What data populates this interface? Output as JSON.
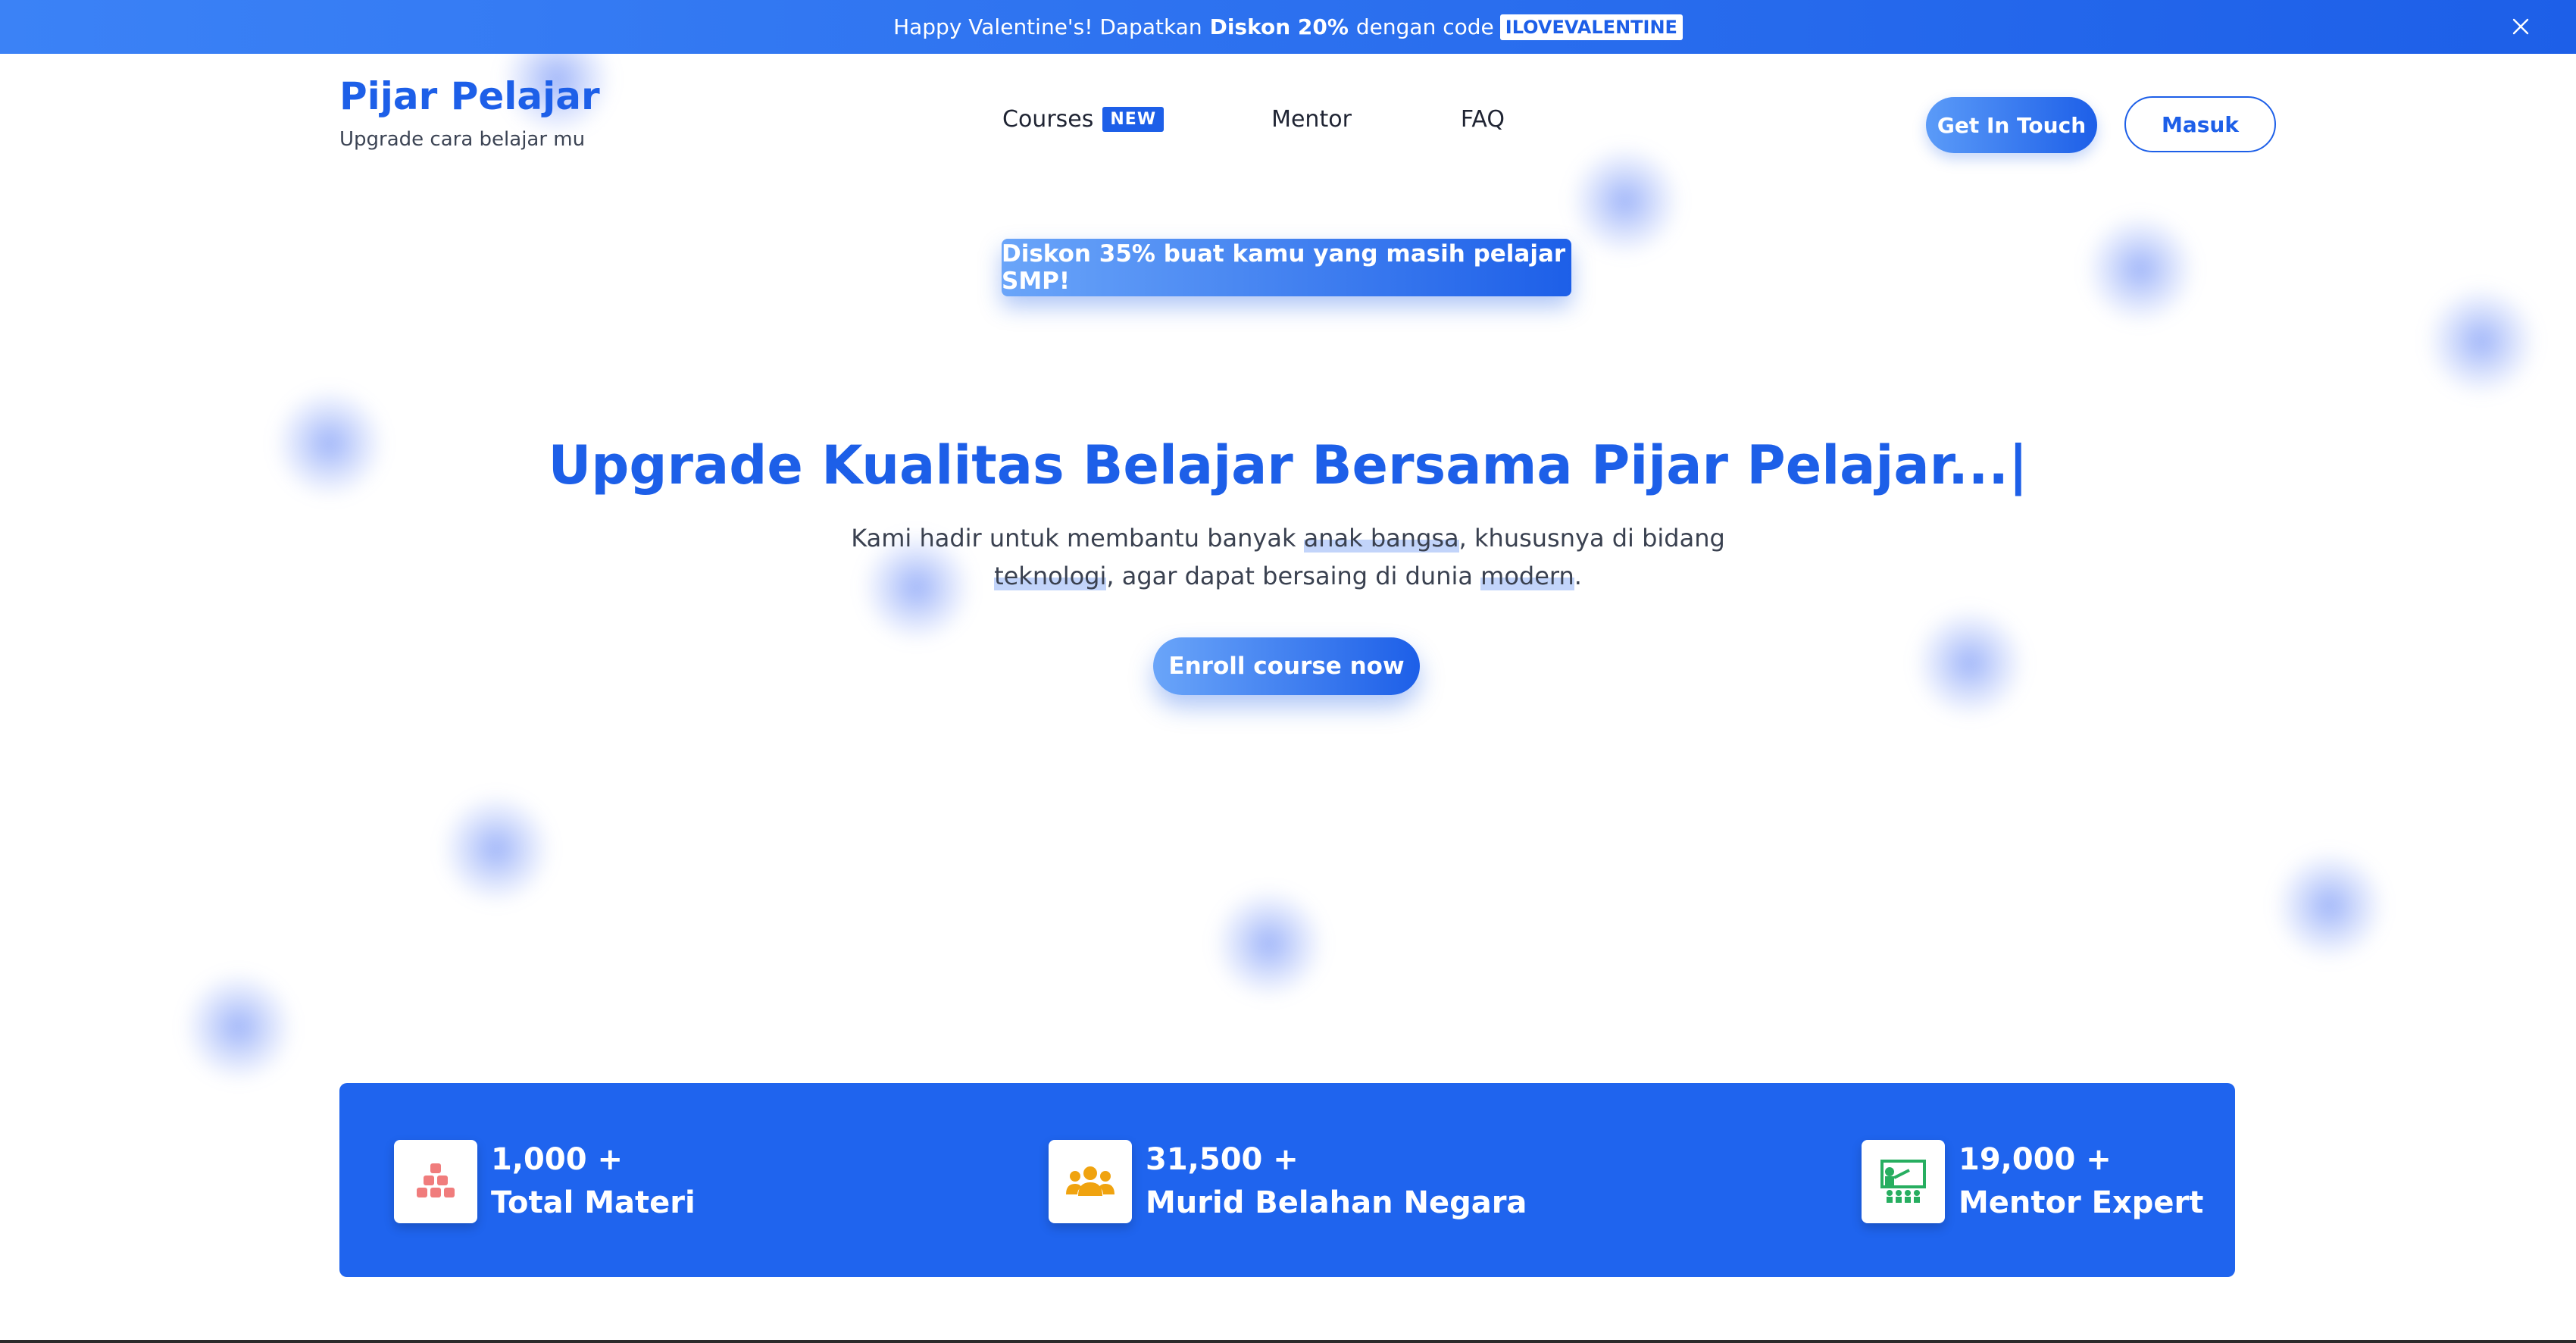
{
  "promo": {
    "text_before": "Happy Valentine's! Dapatkan",
    "strong": "Diskon 20%",
    "text_after": "dengan code",
    "code": "ILOVEVALENTINE",
    "close_icon": "close-icon"
  },
  "brand": {
    "title": "Pijar Pelajar",
    "subtitle": "Upgrade cara belajar mu"
  },
  "nav": {
    "courses": "Courses",
    "courses_badge": "NEW",
    "mentor": "Mentor",
    "faq": "FAQ"
  },
  "header_buttons": {
    "get_in_touch": "Get In Touch",
    "login": "Masuk"
  },
  "hero": {
    "discount": "Diskon 35% buat kamu yang masih pelajar SMP!",
    "title": "Upgrade Kualitas Belajar Bersama Pijar Pelajar...|",
    "desc_1": "Kami hadir untuk membantu banyak",
    "desc_hl_1": "anak bangsa",
    "desc_2": ", khususnya di bidang",
    "desc_hl_2": "teknologi",
    "desc_3": ", agar dapat bersaing di dunia",
    "desc_hl_3": "modern",
    "desc_4": ".",
    "cta": "Enroll course now"
  },
  "stats": [
    {
      "value": "1,000 +",
      "label": "Total Materi",
      "icon": "blocks-icon",
      "color": "#f07c7c"
    },
    {
      "value": "31,500 +",
      "label": "Murid Belahan Negara",
      "icon": "group-icon",
      "color": "#f0a30f"
    },
    {
      "value": "19,000 +",
      "label": "Mentor Expert",
      "icon": "teacher-board-icon",
      "color": "#27ae60"
    }
  ],
  "colors": {
    "primary": "#1d5fe8",
    "stats_bg": "#1f64ee"
  }
}
